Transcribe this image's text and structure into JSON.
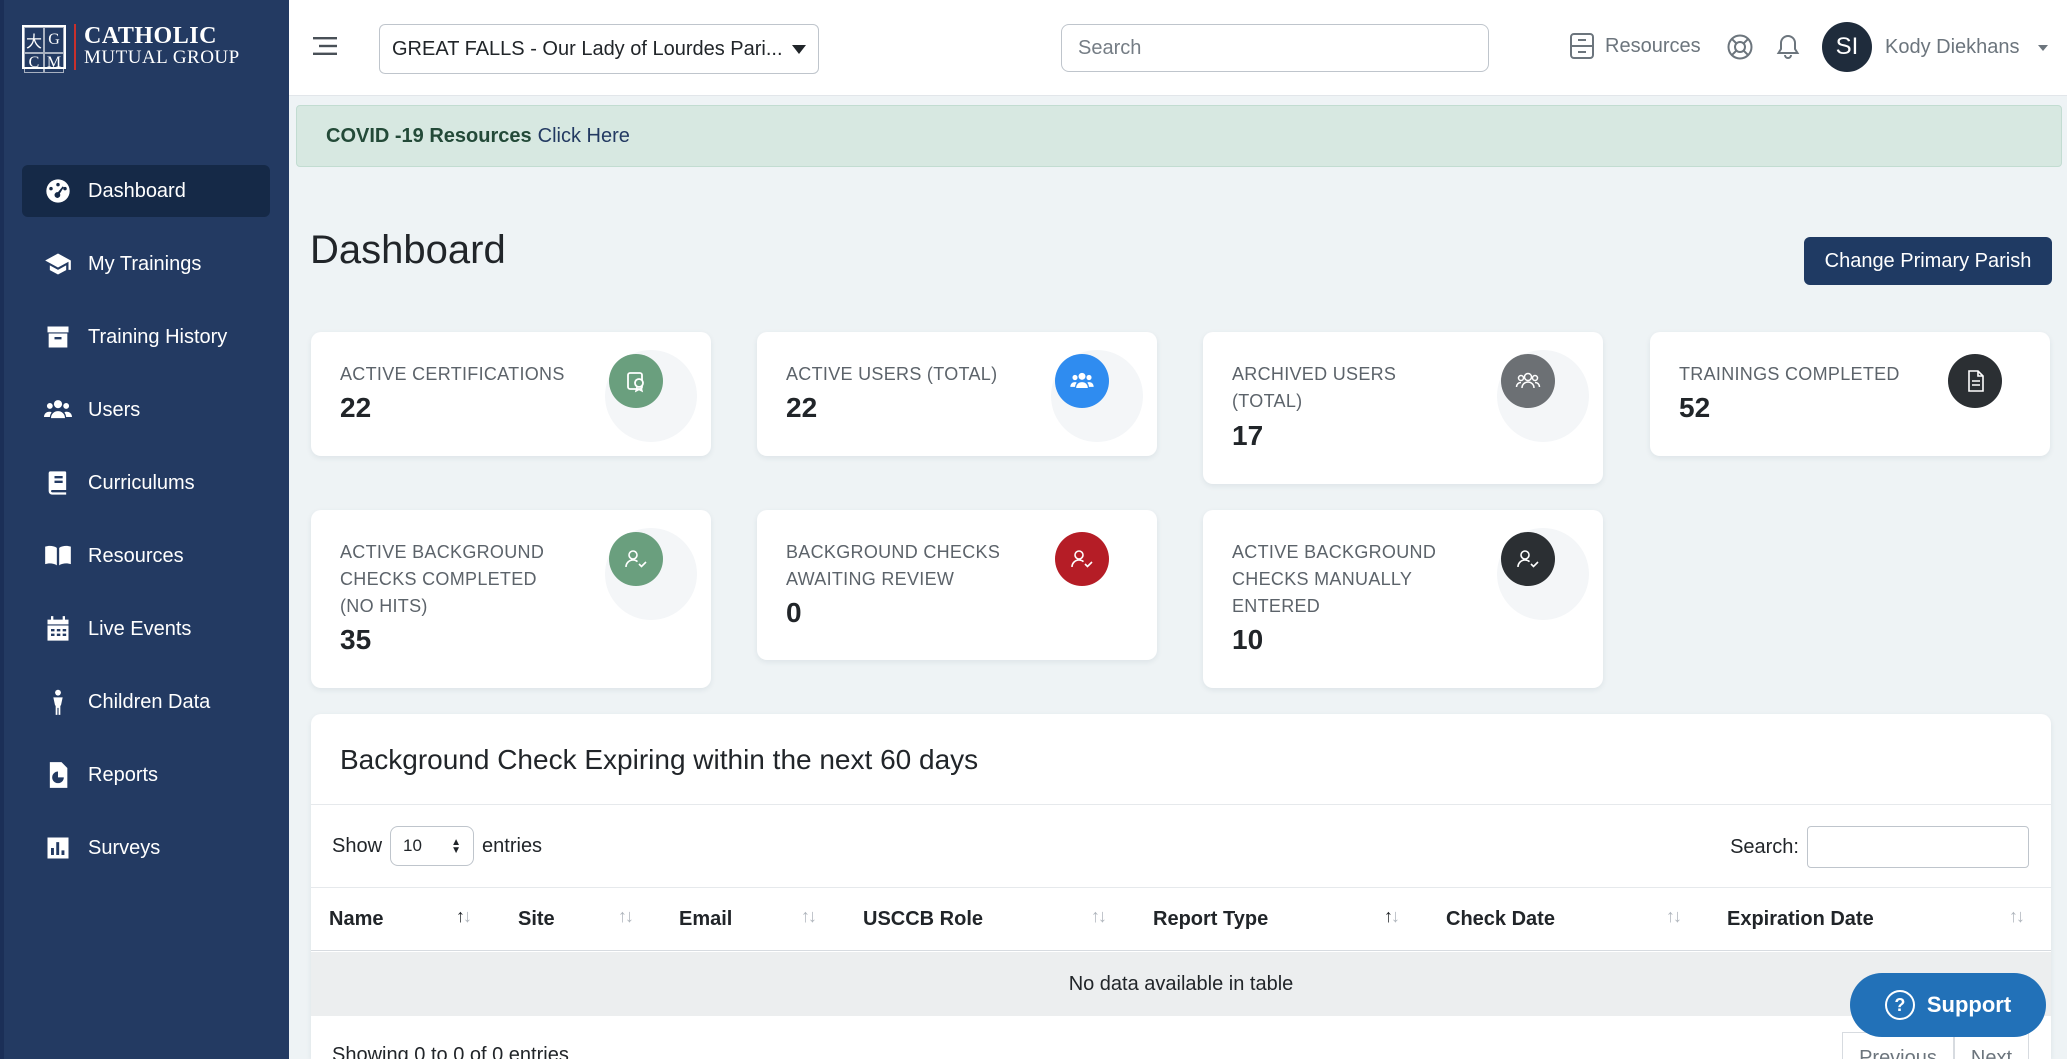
{
  "brand": {
    "line1": "CATHOLIC",
    "line2": "MUTUAL GROUP",
    "mark": [
      "大",
      "G",
      "C",
      "M"
    ]
  },
  "sidebar": {
    "items": [
      {
        "label": "Dashboard",
        "icon": "dashboard-icon",
        "active": true
      },
      {
        "label": "My Trainings",
        "icon": "graduation-cap-icon"
      },
      {
        "label": "Training History",
        "icon": "archive-icon"
      },
      {
        "label": "Users",
        "icon": "users-icon"
      },
      {
        "label": "Curriculums",
        "icon": "book-icon"
      },
      {
        "label": "Resources",
        "icon": "book-open-icon"
      },
      {
        "label": "Live Events",
        "icon": "calendar-icon"
      },
      {
        "label": "Children Data",
        "icon": "child-icon"
      },
      {
        "label": "Reports",
        "icon": "report-icon"
      },
      {
        "label": "Surveys",
        "icon": "chart-icon"
      }
    ]
  },
  "topbar": {
    "parish_selected": "GREAT FALLS - Our Lady of Lourdes Pari...",
    "search_placeholder": "Search",
    "resources_label": "Resources",
    "avatar_initials": "SI",
    "user_name": "Kody Diekhans"
  },
  "alert": {
    "bold": "COVID -19 Resources",
    "link": "Click Here"
  },
  "page": {
    "title": "Dashboard",
    "primary_button": "Change Primary Parish"
  },
  "cards": [
    {
      "label": "ACTIVE CERTIFICATIONS",
      "value": "22",
      "color": "#6a9f7e",
      "icon": "certificate-icon"
    },
    {
      "label": "ACTIVE USERS (TOTAL)",
      "value": "22",
      "color": "#2f8cf0",
      "icon": "users-icon"
    },
    {
      "label": "ARCHIVED USERS (TOTAL)",
      "value": "17",
      "color": "#6c7074",
      "icon": "archived-users-icon"
    },
    {
      "label": "TRAININGS COMPLETED",
      "value": "52",
      "color": "#2b2f33",
      "icon": "document-icon"
    },
    {
      "label": "ACTIVE BACKGROUND CHECKS COMPLETED (NO HITS)",
      "value": "35",
      "color": "#6a9f7e",
      "icon": "user-check-icon"
    },
    {
      "label": "BACKGROUND CHECKS AWAITING REVIEW",
      "value": "0",
      "color": "#b51d26",
      "icon": "user-check-icon"
    },
    {
      "label": "ACTIVE BACKGROUND CHECKS MANUALLY ENTERED",
      "value": "10",
      "color": "#2b2f33",
      "icon": "user-check-icon"
    }
  ],
  "table": {
    "title": "Background Check Expiring within the next 60 days",
    "show_label": "Show",
    "entries_label": "entries",
    "length_value": "10",
    "search_label": "Search:",
    "columns": [
      "Name",
      "Site",
      "Email",
      "USCCB Role",
      "Report Type",
      "Check Date",
      "Expiration Date"
    ],
    "empty_message": "No data available in table",
    "info": "Showing 0 to 0 of 0 entries",
    "prev": "Previous",
    "next": "Next"
  },
  "support": {
    "label": "Support"
  }
}
